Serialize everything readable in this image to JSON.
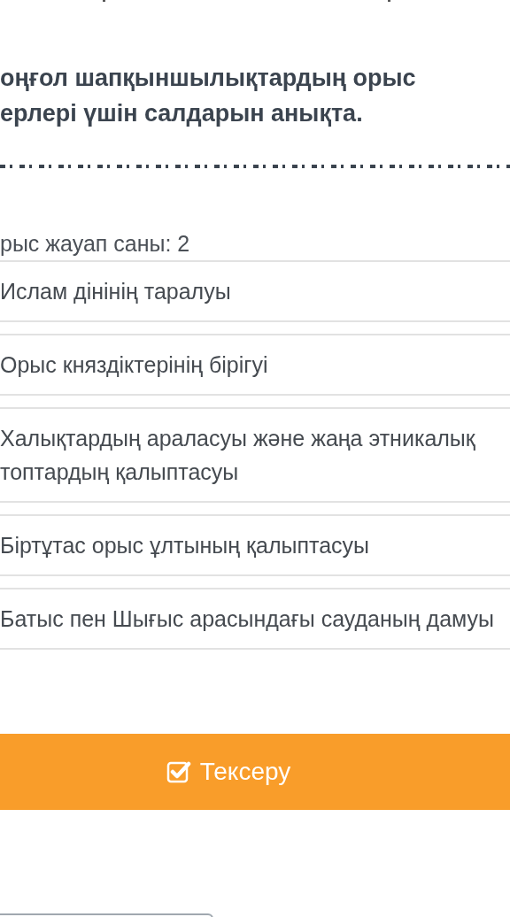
{
  "question": {
    "title": "оңғол шапқыншылықтардың орыс ерлері үшін салдарын анықта.",
    "answer_count": "рыс жауап саны: 2"
  },
  "options": [
    {
      "text": "Ислам дінінің таралуы",
      "selected": false
    },
    {
      "text": "Орыс княздіктерінің бірігуі",
      "selected": false
    },
    {
      "text": "Халықтардың араласуы және жаңа этникалық топтардың қалыптасуы",
      "selected": false
    },
    {
      "text": "Біртұтас орыс ұлтының қалыптасуы",
      "selected": false
    },
    {
      "text": "Батыс пен Шығыс арасындағы сауданың дамуы",
      "selected": false
    }
  ],
  "check_button": {
    "label": "Тексеру"
  }
}
